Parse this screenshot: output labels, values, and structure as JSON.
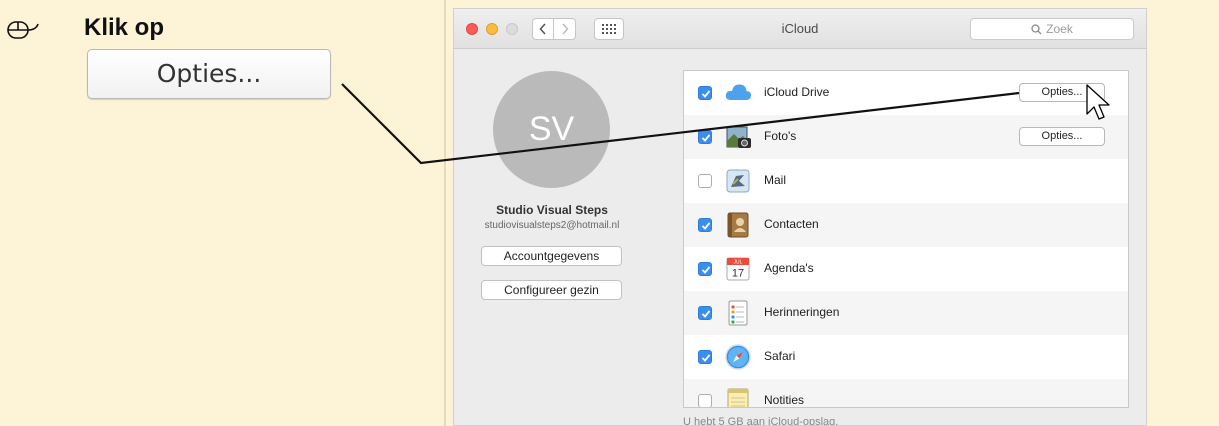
{
  "instruction": {
    "icon": "mouse-icon",
    "title": "Klik op",
    "button_label": "Opties..."
  },
  "window": {
    "title": "iCloud",
    "search_placeholder": "Zoek"
  },
  "account": {
    "initials": "SV",
    "name": "Studio Visual Steps",
    "email": "studiovisualsteps2@hotmail.nl",
    "account_button": "Accountgegevens",
    "family_button": "Configureer gezin"
  },
  "services": [
    {
      "label": "iCloud Drive",
      "checked": true,
      "icon": "icloud-drive-icon",
      "options": "Opties..."
    },
    {
      "label": "Foto's",
      "checked": true,
      "icon": "photos-icon",
      "options": "Opties..."
    },
    {
      "label": "Mail",
      "checked": false,
      "icon": "mail-icon"
    },
    {
      "label": "Contacten",
      "checked": true,
      "icon": "contacts-icon"
    },
    {
      "label": "Agenda's",
      "checked": true,
      "icon": "calendar-icon",
      "calendar_month": "JUL",
      "calendar_day": "17"
    },
    {
      "label": "Herinneringen",
      "checked": true,
      "icon": "reminders-icon"
    },
    {
      "label": "Safari",
      "checked": true,
      "icon": "safari-icon"
    },
    {
      "label": "Notities",
      "checked": false,
      "icon": "notes-icon"
    }
  ],
  "storage_text": "U hebt 5 GB aan iCloud-opslag.",
  "colors": {
    "page_bg": "#fdf3d7",
    "checkbox_blue": "#3b8ef0",
    "close": "#fc5c57",
    "minimize": "#fdbc40"
  }
}
